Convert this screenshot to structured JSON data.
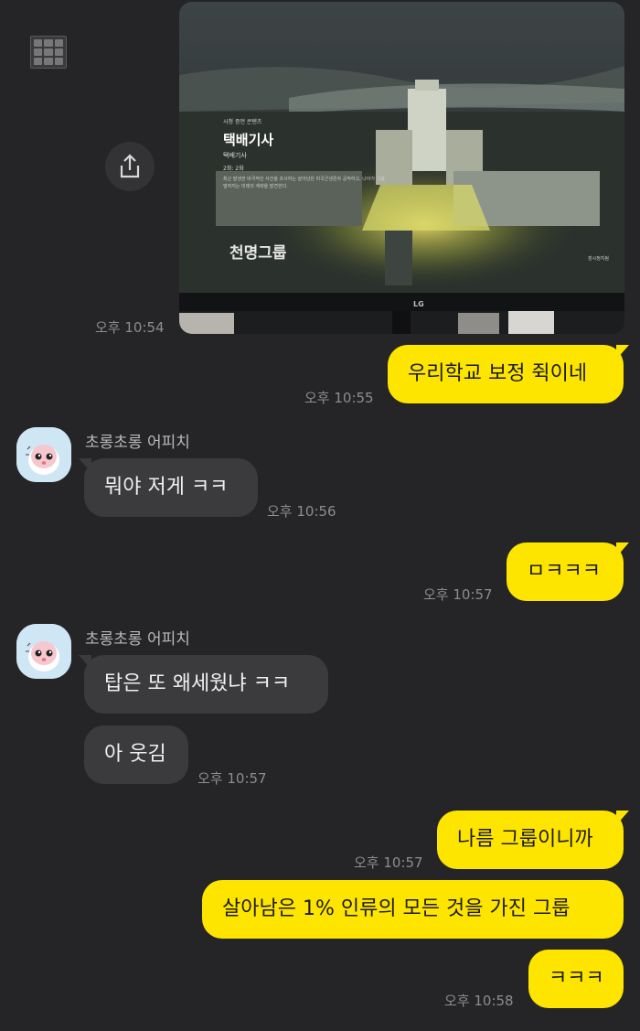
{
  "messages": {
    "photo_time": "오후 10:54",
    "photo": {
      "small_caption": "시청 증언 콘텐츠",
      "title": "택배기사",
      "subtitle": "택배기사",
      "episode": "2화: 2화",
      "description_line1": "최근 발생한 비극적인 사건을 조사하는 살아남은 미국군생존자 공작하고, 나아가 그를",
      "description_line2": "벌여지는 미래의 계략을 발견한다.",
      "group_text": "천명그룹",
      "brand": "LG",
      "corner_label": "잠시정지됨"
    },
    "me1": {
      "text": "우리학교 보정 쥑이네",
      "time": "오후 10:55"
    },
    "other_block1": {
      "sender": "초롱초롱 어피치",
      "bubbles": [
        {
          "text": "뭐야 저게 ㅋㅋ"
        }
      ],
      "time": "오후 10:56"
    },
    "me2": {
      "text": "ㅁㅋㅋㅋ",
      "time": "오후 10:57"
    },
    "other_block2": {
      "sender": "초롱초롱 어피치",
      "bubbles": [
        {
          "text": "탑은 또 왜세웠냐 ㅋㅋ"
        },
        {
          "text": "아 웃김"
        }
      ],
      "time": "오후 10:57"
    },
    "me3": {
      "bubbles": [
        {
          "text": "나름 그룹이니까"
        },
        {
          "text": "살아남은 1% 인류의 모든 것을 가진 그룹"
        }
      ],
      "time": "오후 10:57"
    },
    "me4": {
      "text": "ㅋㅋㅋ",
      "time": "오후 10:58"
    }
  },
  "icons": {
    "share": "share-icon",
    "avatar": "apeach-avatar-icon",
    "stamp": "stamp-logo-icon"
  },
  "colors": {
    "background": "#252527",
    "my_bubble": "#fee500",
    "other_bubble": "#3b3b3e",
    "timestamp": "#8d8d90"
  }
}
